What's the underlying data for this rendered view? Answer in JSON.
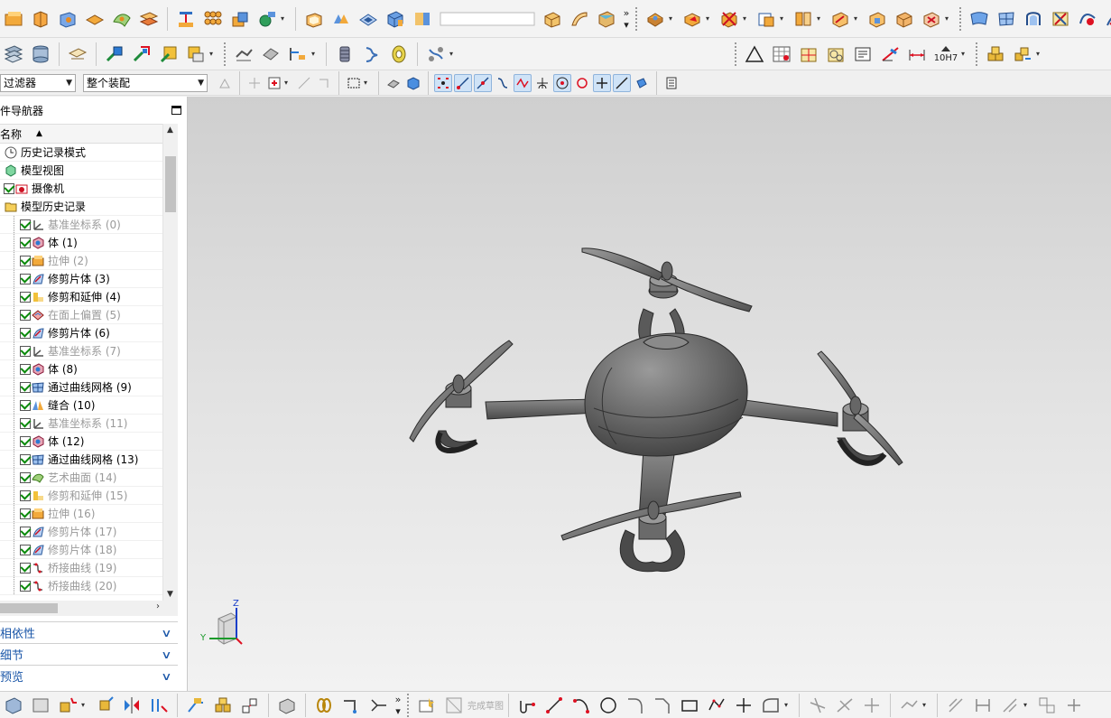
{
  "colors": {
    "accent": "#1a56a8",
    "checked": "#0a8a0a",
    "viewport_top": "#cfcfcf",
    "viewport_bottom": "#f2f2f2"
  },
  "toolbar_row2": {
    "fit_label": "10H7"
  },
  "selection_bar": {
    "type_filter": "过滤器",
    "scope_filter": "整个装配"
  },
  "navigator": {
    "title": "件导航器",
    "column_name": "名称",
    "items": [
      {
        "label": "历史记录模式",
        "icon": "clock-icon",
        "checked": false,
        "gray": false
      },
      {
        "label": "模型视图",
        "icon": "model-view-icon",
        "checked": false,
        "gray": false
      },
      {
        "label": "摄像机",
        "icon": "camera-icon",
        "checked": true,
        "gray": false
      },
      {
        "label": "模型历史记录",
        "icon": "folder-icon",
        "checked": false,
        "gray": false
      },
      {
        "label": "基准坐标系 (0)",
        "icon": "datum-csys-icon",
        "checked": true,
        "gray": true
      },
      {
        "label": "体 (1)",
        "icon": "body-icon",
        "checked": true,
        "gray": false
      },
      {
        "label": "拉伸 (2)",
        "icon": "extrude-icon",
        "checked": true,
        "gray": true
      },
      {
        "label": "修剪片体 (3)",
        "icon": "trim-sheet-icon",
        "checked": true,
        "gray": false
      },
      {
        "label": "修剪和延伸 (4)",
        "icon": "trim-extend-icon",
        "checked": true,
        "gray": false
      },
      {
        "label": "在面上偏置 (5)",
        "icon": "offset-face-icon",
        "checked": true,
        "gray": true
      },
      {
        "label": "修剪片体 (6)",
        "icon": "trim-sheet-icon",
        "checked": true,
        "gray": false
      },
      {
        "label": "基准坐标系 (7)",
        "icon": "datum-csys-icon",
        "checked": true,
        "gray": true
      },
      {
        "label": "体 (8)",
        "icon": "body-icon",
        "checked": true,
        "gray": false
      },
      {
        "label": "通过曲线网格 (9)",
        "icon": "curve-mesh-icon",
        "checked": true,
        "gray": false
      },
      {
        "label": "缝合 (10)",
        "icon": "sew-icon",
        "checked": true,
        "gray": false
      },
      {
        "label": "基准坐标系 (11)",
        "icon": "datum-csys-icon",
        "checked": true,
        "gray": true
      },
      {
        "label": "体 (12)",
        "icon": "body-icon",
        "checked": true,
        "gray": false
      },
      {
        "label": "通过曲线网格 (13)",
        "icon": "curve-mesh-icon",
        "checked": true,
        "gray": false
      },
      {
        "label": "艺术曲面 (14)",
        "icon": "studio-surface-icon",
        "checked": true,
        "gray": true
      },
      {
        "label": "修剪和延伸 (15)",
        "icon": "trim-extend-icon",
        "checked": true,
        "gray": true
      },
      {
        "label": "拉伸 (16)",
        "icon": "extrude-icon",
        "checked": true,
        "gray": true
      },
      {
        "label": "修剪片体 (17)",
        "icon": "trim-sheet-icon",
        "checked": true,
        "gray": true
      },
      {
        "label": "修剪片体 (18)",
        "icon": "trim-sheet-icon",
        "checked": true,
        "gray": true
      },
      {
        "label": "桥接曲线 (19)",
        "icon": "bridge-curve-icon",
        "checked": true,
        "gray": true
      },
      {
        "label": "桥接曲线 (20)",
        "icon": "bridge-curve-icon",
        "checked": true,
        "gray": true
      }
    ],
    "panels": [
      {
        "label": "相依性"
      },
      {
        "label": "细节"
      },
      {
        "label": "预览"
      }
    ]
  },
  "viewport": {
    "triad": {
      "z_label": "Z",
      "y_label": "Y"
    }
  },
  "sketch_bar": {
    "finish_sketch": "完成草图"
  }
}
